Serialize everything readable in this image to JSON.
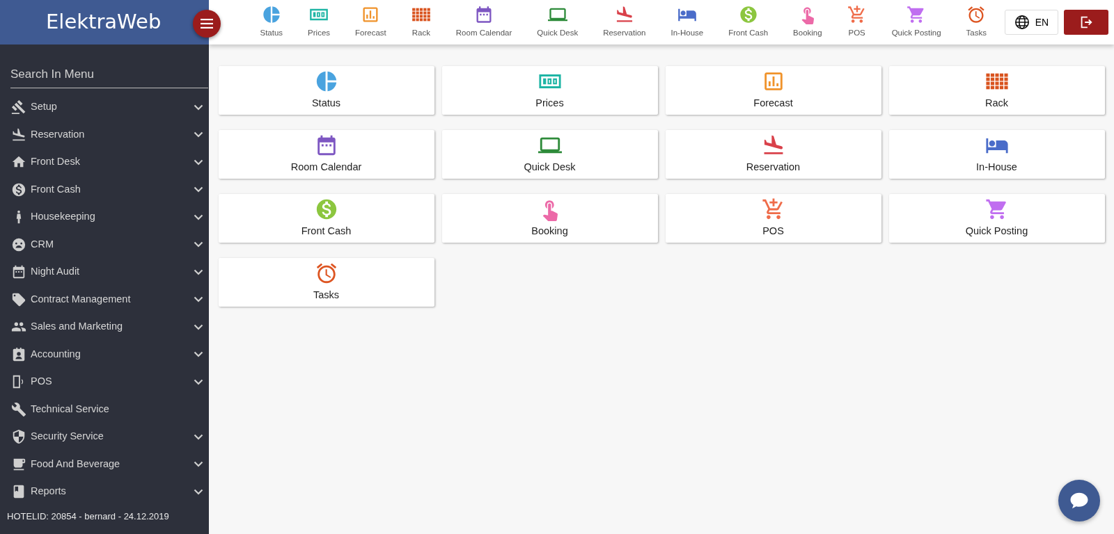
{
  "sidebar": {
    "logo": "ElektraWeb",
    "search": {
      "placeholder": "Search In Menu"
    },
    "items": [
      {
        "label": "Setup",
        "expandable": true
      },
      {
        "label": "Reservation",
        "expandable": true
      },
      {
        "label": "Front Desk",
        "expandable": true
      },
      {
        "label": "Front Cash",
        "expandable": true
      },
      {
        "label": "Housekeeping",
        "expandable": true
      },
      {
        "label": "CRM",
        "expandable": true
      },
      {
        "label": "Night Audit",
        "expandable": true
      },
      {
        "label": "Contract Management",
        "expandable": true
      },
      {
        "label": "Sales and Marketing",
        "expandable": true
      },
      {
        "label": "Accounting",
        "expandable": true
      },
      {
        "label": "POS",
        "expandable": true
      },
      {
        "label": "Technical Service",
        "expandable": false
      },
      {
        "label": "Security Service",
        "expandable": true
      },
      {
        "label": "Food And Beverage",
        "expandable": true
      },
      {
        "label": "Reports",
        "expandable": true
      }
    ],
    "footer": "HOTELID: 20854 - bernard - 24.12.2019"
  },
  "toolbar": {
    "items": [
      "Status",
      "Prices",
      "Forecast",
      "Rack",
      "Room Calendar",
      "Quick Desk",
      "Reservation",
      "In-House",
      "Front Cash",
      "Booking",
      "POS",
      "Quick Posting",
      "Tasks"
    ],
    "language": "EN"
  },
  "tiles": [
    "Status",
    "Prices",
    "Forecast",
    "Rack",
    "Room Calendar",
    "Quick Desk",
    "Reservation",
    "In-House",
    "Front Cash",
    "Booking",
    "POS",
    "Quick Posting",
    "Tasks"
  ]
}
